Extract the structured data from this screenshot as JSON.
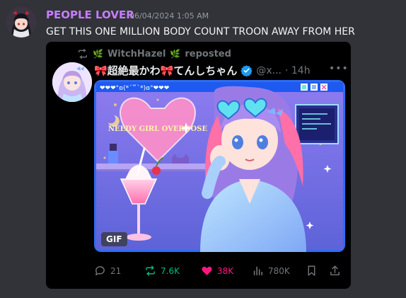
{
  "message": {
    "username": "PEOPLE LOVER",
    "timestamp": "06/04/2024 1:05 AM",
    "text": "GET THIS ONE MILLION BODY COUNT TROON AWAY FROM HER"
  },
  "embed": {
    "repost_label": "WitchHazel",
    "repost_suffix": "reposted",
    "author_name": "🎀超絶最かわ🎀てんしちゃん",
    "author_handle": "@x...",
    "time_ago": "· 14h",
    "media": {
      "banner_text": "❤❤❤°ʚ(*´꒳`*)ɞ°❤❤❤",
      "sign_text": "NEEDY GIRL OVERDOSE",
      "badge": "GIF"
    },
    "stats": {
      "replies": "21",
      "reposts": "7.6K",
      "likes": "38K",
      "views": "780K"
    }
  },
  "colors": {
    "background": "#313338",
    "username": "#c77dff",
    "repost_green": "#00ba7c",
    "like_pink": "#f91880",
    "muted": "#71767b"
  }
}
